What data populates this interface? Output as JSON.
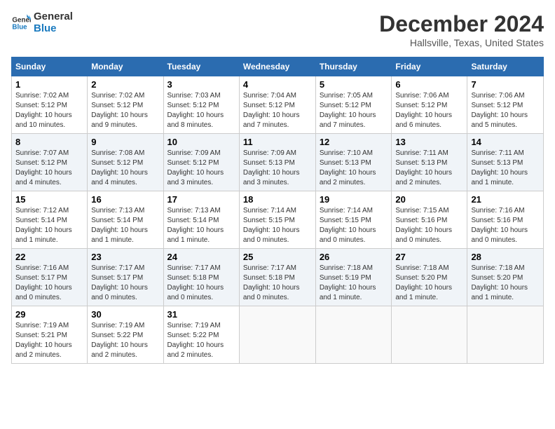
{
  "header": {
    "logo_line1": "General",
    "logo_line2": "Blue",
    "month": "December 2024",
    "location": "Hallsville, Texas, United States"
  },
  "days_of_week": [
    "Sunday",
    "Monday",
    "Tuesday",
    "Wednesday",
    "Thursday",
    "Friday",
    "Saturday"
  ],
  "weeks": [
    [
      {
        "day": "1",
        "info": "Sunrise: 7:02 AM\nSunset: 5:12 PM\nDaylight: 10 hours and 10 minutes."
      },
      {
        "day": "2",
        "info": "Sunrise: 7:02 AM\nSunset: 5:12 PM\nDaylight: 10 hours and 9 minutes."
      },
      {
        "day": "3",
        "info": "Sunrise: 7:03 AM\nSunset: 5:12 PM\nDaylight: 10 hours and 8 minutes."
      },
      {
        "day": "4",
        "info": "Sunrise: 7:04 AM\nSunset: 5:12 PM\nDaylight: 10 hours and 7 minutes."
      },
      {
        "day": "5",
        "info": "Sunrise: 7:05 AM\nSunset: 5:12 PM\nDaylight: 10 hours and 7 minutes."
      },
      {
        "day": "6",
        "info": "Sunrise: 7:06 AM\nSunset: 5:12 PM\nDaylight: 10 hours and 6 minutes."
      },
      {
        "day": "7",
        "info": "Sunrise: 7:06 AM\nSunset: 5:12 PM\nDaylight: 10 hours and 5 minutes."
      }
    ],
    [
      {
        "day": "8",
        "info": "Sunrise: 7:07 AM\nSunset: 5:12 PM\nDaylight: 10 hours and 4 minutes."
      },
      {
        "day": "9",
        "info": "Sunrise: 7:08 AM\nSunset: 5:12 PM\nDaylight: 10 hours and 4 minutes."
      },
      {
        "day": "10",
        "info": "Sunrise: 7:09 AM\nSunset: 5:12 PM\nDaylight: 10 hours and 3 minutes."
      },
      {
        "day": "11",
        "info": "Sunrise: 7:09 AM\nSunset: 5:13 PM\nDaylight: 10 hours and 3 minutes."
      },
      {
        "day": "12",
        "info": "Sunrise: 7:10 AM\nSunset: 5:13 PM\nDaylight: 10 hours and 2 minutes."
      },
      {
        "day": "13",
        "info": "Sunrise: 7:11 AM\nSunset: 5:13 PM\nDaylight: 10 hours and 2 minutes."
      },
      {
        "day": "14",
        "info": "Sunrise: 7:11 AM\nSunset: 5:13 PM\nDaylight: 10 hours and 1 minute."
      }
    ],
    [
      {
        "day": "15",
        "info": "Sunrise: 7:12 AM\nSunset: 5:14 PM\nDaylight: 10 hours and 1 minute."
      },
      {
        "day": "16",
        "info": "Sunrise: 7:13 AM\nSunset: 5:14 PM\nDaylight: 10 hours and 1 minute."
      },
      {
        "day": "17",
        "info": "Sunrise: 7:13 AM\nSunset: 5:14 PM\nDaylight: 10 hours and 1 minute."
      },
      {
        "day": "18",
        "info": "Sunrise: 7:14 AM\nSunset: 5:15 PM\nDaylight: 10 hours and 0 minutes."
      },
      {
        "day": "19",
        "info": "Sunrise: 7:14 AM\nSunset: 5:15 PM\nDaylight: 10 hours and 0 minutes."
      },
      {
        "day": "20",
        "info": "Sunrise: 7:15 AM\nSunset: 5:16 PM\nDaylight: 10 hours and 0 minutes."
      },
      {
        "day": "21",
        "info": "Sunrise: 7:16 AM\nSunset: 5:16 PM\nDaylight: 10 hours and 0 minutes."
      }
    ],
    [
      {
        "day": "22",
        "info": "Sunrise: 7:16 AM\nSunset: 5:17 PM\nDaylight: 10 hours and 0 minutes."
      },
      {
        "day": "23",
        "info": "Sunrise: 7:17 AM\nSunset: 5:17 PM\nDaylight: 10 hours and 0 minutes."
      },
      {
        "day": "24",
        "info": "Sunrise: 7:17 AM\nSunset: 5:18 PM\nDaylight: 10 hours and 0 minutes."
      },
      {
        "day": "25",
        "info": "Sunrise: 7:17 AM\nSunset: 5:18 PM\nDaylight: 10 hours and 0 minutes."
      },
      {
        "day": "26",
        "info": "Sunrise: 7:18 AM\nSunset: 5:19 PM\nDaylight: 10 hours and 1 minute."
      },
      {
        "day": "27",
        "info": "Sunrise: 7:18 AM\nSunset: 5:20 PM\nDaylight: 10 hours and 1 minute."
      },
      {
        "day": "28",
        "info": "Sunrise: 7:18 AM\nSunset: 5:20 PM\nDaylight: 10 hours and 1 minute."
      }
    ],
    [
      {
        "day": "29",
        "info": "Sunrise: 7:19 AM\nSunset: 5:21 PM\nDaylight: 10 hours and 2 minutes."
      },
      {
        "day": "30",
        "info": "Sunrise: 7:19 AM\nSunset: 5:22 PM\nDaylight: 10 hours and 2 minutes."
      },
      {
        "day": "31",
        "info": "Sunrise: 7:19 AM\nSunset: 5:22 PM\nDaylight: 10 hours and 2 minutes."
      },
      null,
      null,
      null,
      null
    ]
  ]
}
